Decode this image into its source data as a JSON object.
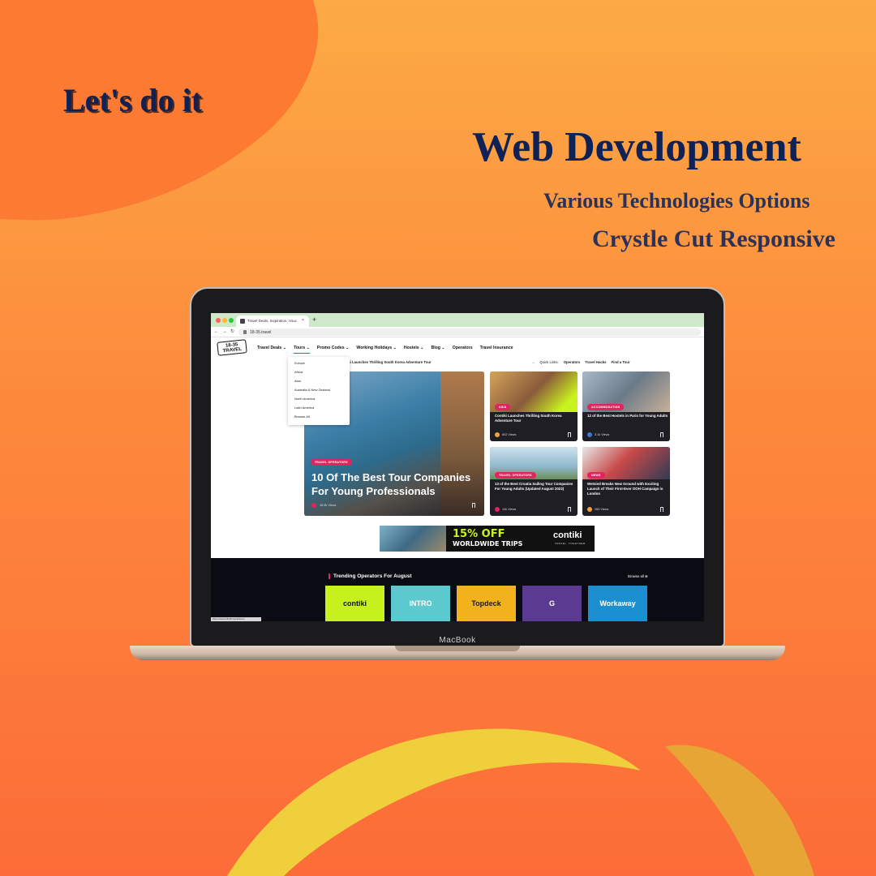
{
  "promo": {
    "tagline": "Let's do it",
    "headline": "Web Development",
    "sub1": "Various Technologies Options",
    "sub2": "Crystle Cut Responsive"
  },
  "device": {
    "brand": "MacBook"
  },
  "browser": {
    "tab_title": "Travel Deals, Inspiration, Vouc",
    "tab_close": "×",
    "new_tab": "+",
    "url": "18-35.travel"
  },
  "site": {
    "logo": "18-35 TRAVEL",
    "nav": [
      "Travel Deals ⌄",
      "Tours ⌄",
      "Promo Codes ⌄",
      "Working Holidays ⌄",
      "Hostels ⌄",
      "Blog ⌄",
      "Operators",
      "Travel Insurance"
    ],
    "dropdown": [
      "Europe",
      "Africa",
      "Asia",
      "Australia & New Zealand",
      "North America",
      "Latin America",
      "Browse All"
    ],
    "ticker": "iki Launches Thrilling South Korea Adventure Tour",
    "ticker_arrow": "→",
    "quick_links_label": "Quick Links:",
    "quick_links": [
      "Operators",
      "Travel Hacks",
      "Find a Tour"
    ]
  },
  "cards": {
    "feature": {
      "badge": "TRAVEL OPERATORS",
      "title": "10 Of The Best Tour Companies For Young Professionals",
      "views": "18.5k Views"
    },
    "small": [
      {
        "badge": "ASIA",
        "title": "Contiki Launches Thrilling South Korea Adventure Tour",
        "views": "602 Views"
      },
      {
        "badge": "ACCOMMODATION",
        "title": "12 of the Best Hostels in Paris for Young Adults",
        "views": "3.1k Views"
      },
      {
        "badge": "TRAVEL OPERATORS",
        "title": "13 of the Best Croatia Sailing Tour Companies For Young Adults (Updated August 2023)",
        "views": "14k Views"
      },
      {
        "badge": "NEWS",
        "title": "Wetsied Breaks New Ground with Exciting Launch of Their First-Ever OOH Campaign in London",
        "views": "260 Views"
      }
    ]
  },
  "banner": {
    "offer": "15% OFF",
    "offer_sub": "WORLDWIDE TRIPS",
    "brand": "contiki",
    "brand_sub": "TRAVEL. TOGETHER."
  },
  "trending": {
    "title": "Trending Operators For August",
    "browse": "Browse all ⊕",
    "operators": [
      {
        "name": "contiki",
        "bg": "#c6f11c",
        "fg": "#111111"
      },
      {
        "name": "INTRO",
        "bg": "#5cc9cf",
        "fg": "#ffffff"
      },
      {
        "name": "Topdeck",
        "bg": "#f2b21e",
        "fg": "#1b1b1b"
      },
      {
        "name": "G",
        "bg": "#5b3a92",
        "fg": "#ffffff"
      },
      {
        "name": "Workaway",
        "bg": "#1b8fd0",
        "fg": "#ffffff"
      }
    ]
  },
  "statusbar": "https://www.18-35.travel/tours",
  "colors": {
    "accent": "#e0245e",
    "headline": "#0f2257",
    "lime": "#c9f31d"
  }
}
